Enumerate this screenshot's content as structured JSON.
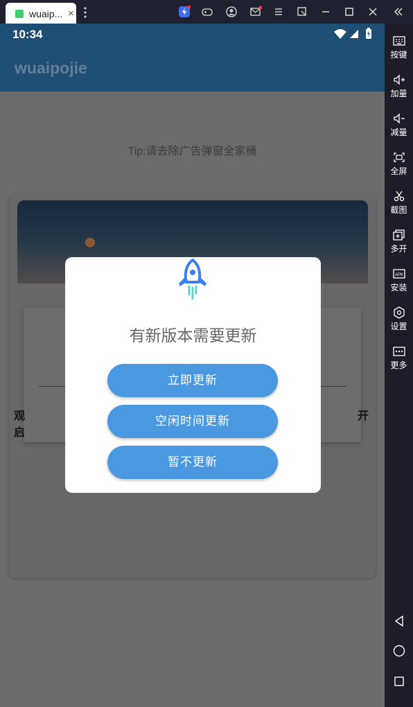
{
  "window": {
    "tab_title": "wuaip...",
    "tab_close": "×"
  },
  "status": {
    "time": "10:34"
  },
  "app": {
    "title": "wuaipojie",
    "tip": "Tip:请去除广告弹窗全家桶"
  },
  "background_fragments": {
    "left1": "观",
    "left2": "启",
    "right": "开"
  },
  "dialog": {
    "title": "有新版本需要更新",
    "buttons": [
      {
        "label": "立即更新"
      },
      {
        "label": "空闲时间更新"
      },
      {
        "label": "暂不更新"
      }
    ],
    "icon": "rocket-icon"
  },
  "sidebar": {
    "items": [
      {
        "label": "按键",
        "icon": "keyboard-icon"
      },
      {
        "label": "加量",
        "icon": "volume-up-icon"
      },
      {
        "label": "减量",
        "icon": "volume-down-icon"
      },
      {
        "label": "全屏",
        "icon": "fullscreen-icon"
      },
      {
        "label": "截图",
        "icon": "scissors-icon"
      },
      {
        "label": "多开",
        "icon": "multi-instance-icon"
      },
      {
        "label": "安装",
        "icon": "apk-icon"
      },
      {
        "label": "设置",
        "icon": "settings-icon"
      },
      {
        "label": "更多",
        "icon": "more-icon"
      }
    ],
    "nav": [
      "back-icon",
      "home-icon",
      "recents-icon"
    ]
  },
  "colors": {
    "accent_button": "#4a98e0",
    "appbar": "#1f4e74",
    "scrim": "#6b6b6b"
  }
}
